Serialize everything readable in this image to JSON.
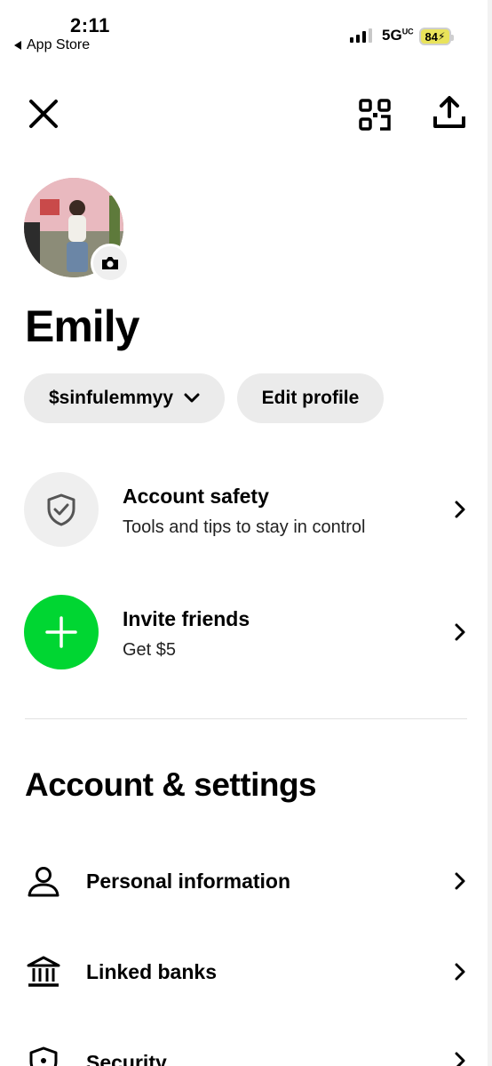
{
  "status_bar": {
    "time": "2:11",
    "back_app": "App Store",
    "network": "5G",
    "network_sup": "UC",
    "battery": "84"
  },
  "header": {
    "close_icon": "close-icon",
    "qr_icon": "qr-scan-icon",
    "share_icon": "share-icon"
  },
  "profile": {
    "name": "Emily",
    "cashtag": "$sinfulemmyy",
    "edit_label": "Edit profile"
  },
  "cards": [
    {
      "title": "Account safety",
      "subtitle": "Tools and tips to stay in control",
      "icon": "shield-check-icon"
    },
    {
      "title": "Invite friends",
      "subtitle": "Get $5",
      "icon": "plus-icon"
    }
  ],
  "section": {
    "title": "Account & settings",
    "items": [
      {
        "label": "Personal information",
        "icon": "person-icon"
      },
      {
        "label": "Linked banks",
        "icon": "bank-icon"
      },
      {
        "label": "Security",
        "icon": "shield-lock-icon"
      }
    ]
  },
  "colors": {
    "accent_green": "#00d632",
    "pill_gray": "#ebebeb",
    "battery_yellow": "#e9e35a"
  }
}
